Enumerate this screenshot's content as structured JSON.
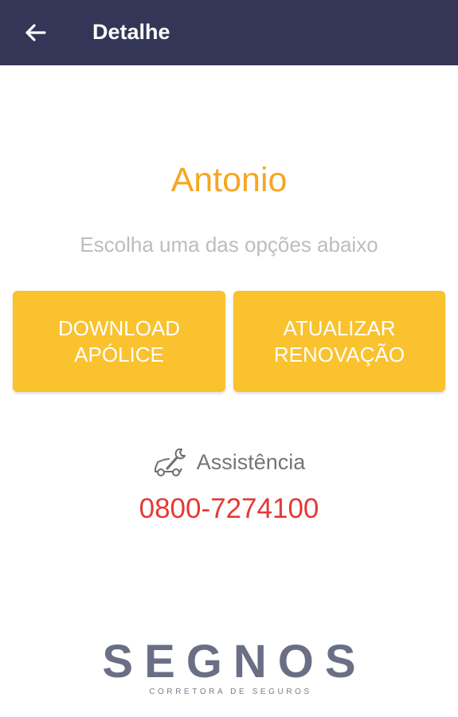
{
  "appbar": {
    "title": "Detalhe",
    "back_icon": "arrow-left-icon",
    "background": "#333656"
  },
  "main": {
    "user_name": "Antonio",
    "subtitle": "Escolha uma das opções abaixo",
    "buttons": [
      {
        "label": "DOWNLOAD\nAPÓLICE"
      },
      {
        "label": "ATUALIZAR\nRENOVAÇÃO"
      }
    ],
    "button_color": "#f9c22e",
    "name_color": "#f5a623"
  },
  "assistance": {
    "icon": "wrench-car-icon",
    "label": "Assistência",
    "phone": "0800-7274100",
    "phone_color": "#e53935"
  },
  "logo": {
    "name": "SEGNOS",
    "tagline": "CORRETORA DE SEGUROS"
  }
}
